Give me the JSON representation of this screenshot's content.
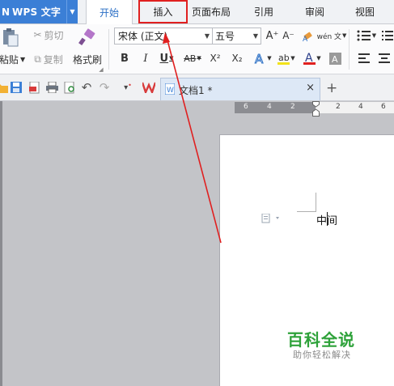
{
  "app": {
    "title": "WPS 文字",
    "accent": "#3b7fd6"
  },
  "tabs": [
    {
      "label": "开始",
      "active": true
    },
    {
      "label": "插入",
      "highlighted": true
    },
    {
      "label": "页面布局"
    },
    {
      "label": "引用"
    },
    {
      "label": "审阅"
    },
    {
      "label": "视图"
    }
  ],
  "ribbon": {
    "paste_label": "粘贴",
    "cut_label": "剪切",
    "copy_label": "复制",
    "format_painter_label": "格式刷",
    "font_name": "宋体 (正文)",
    "font_size": "五号",
    "bold": "B",
    "italic": "I",
    "underline": "U",
    "strikethrough": "AB",
    "superscript": "X²",
    "subscript": "X₂",
    "grow_font": "A⁺",
    "shrink_font": "A⁻",
    "phonetic": "wén 文",
    "font_color_letter": "A"
  },
  "document_tab": {
    "name": "文档1 *",
    "close": "×",
    "add": "+"
  },
  "ruler": {
    "left_numbers": [
      "6",
      "4",
      "2"
    ],
    "right_numbers": [
      "2",
      "4",
      "6"
    ]
  },
  "page": {
    "text": "中间"
  },
  "watermark": {
    "title": "百科全说",
    "subtitle": "助你轻松解决"
  },
  "annotation": {
    "color": "#e02020",
    "description": "arrow from document to 插入 tab"
  }
}
